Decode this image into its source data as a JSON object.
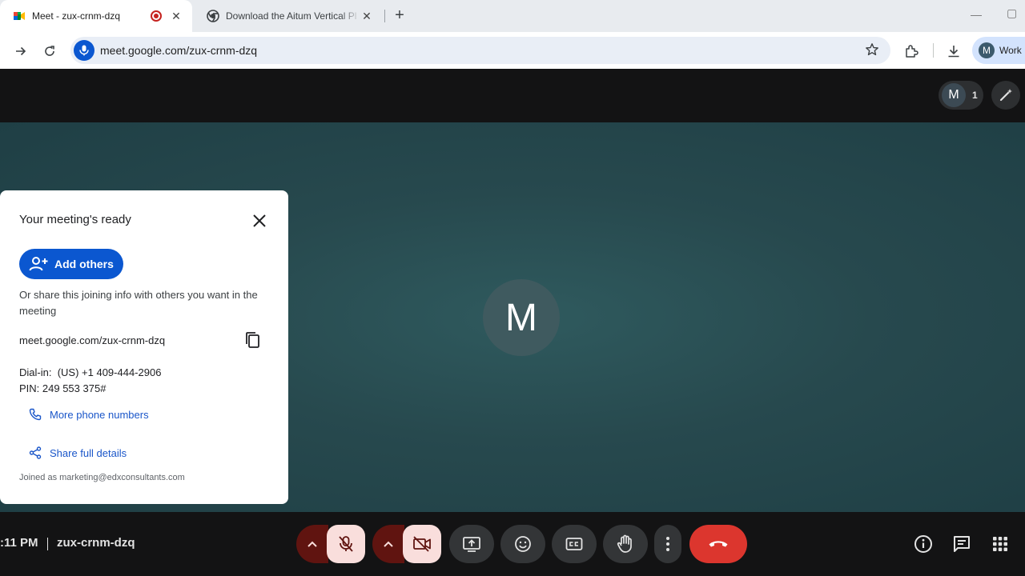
{
  "browser": {
    "tabs": [
      {
        "title": "Meet - zux-crnm-dzq",
        "active": true,
        "recording": true
      },
      {
        "title": "Download the Aitum Vertical Pl",
        "active": false
      }
    ],
    "url": "meet.google.com/zux-crnm-dzq",
    "profile": {
      "initial": "M",
      "label": "Work"
    }
  },
  "meet": {
    "participant_initial": "M",
    "participant_count": "1"
  },
  "card": {
    "title": "Your meeting's ready",
    "add_others_label": "Add others",
    "share_text": "Or share this joining info with others you want in the meeting",
    "meeting_link": "meet.google.com/zux-crnm-dzq",
    "dialin_label": "Dial-in:",
    "dialin_number": "(US) +1 409-444-2906",
    "pin_text": "PIN: 249 553 375#",
    "more_numbers_label": "More phone numbers",
    "share_details_label": "Share full details",
    "joined_as": "Joined as marketing@edxconsultants.com"
  },
  "controls": {
    "time": ":11 PM",
    "meeting_code": "zux-crnm-dzq"
  },
  "colors": {
    "accent": "#0b57d0",
    "end_call": "#dc362e",
    "muted_bg": "#f9dedc",
    "stage": "#27494e"
  }
}
